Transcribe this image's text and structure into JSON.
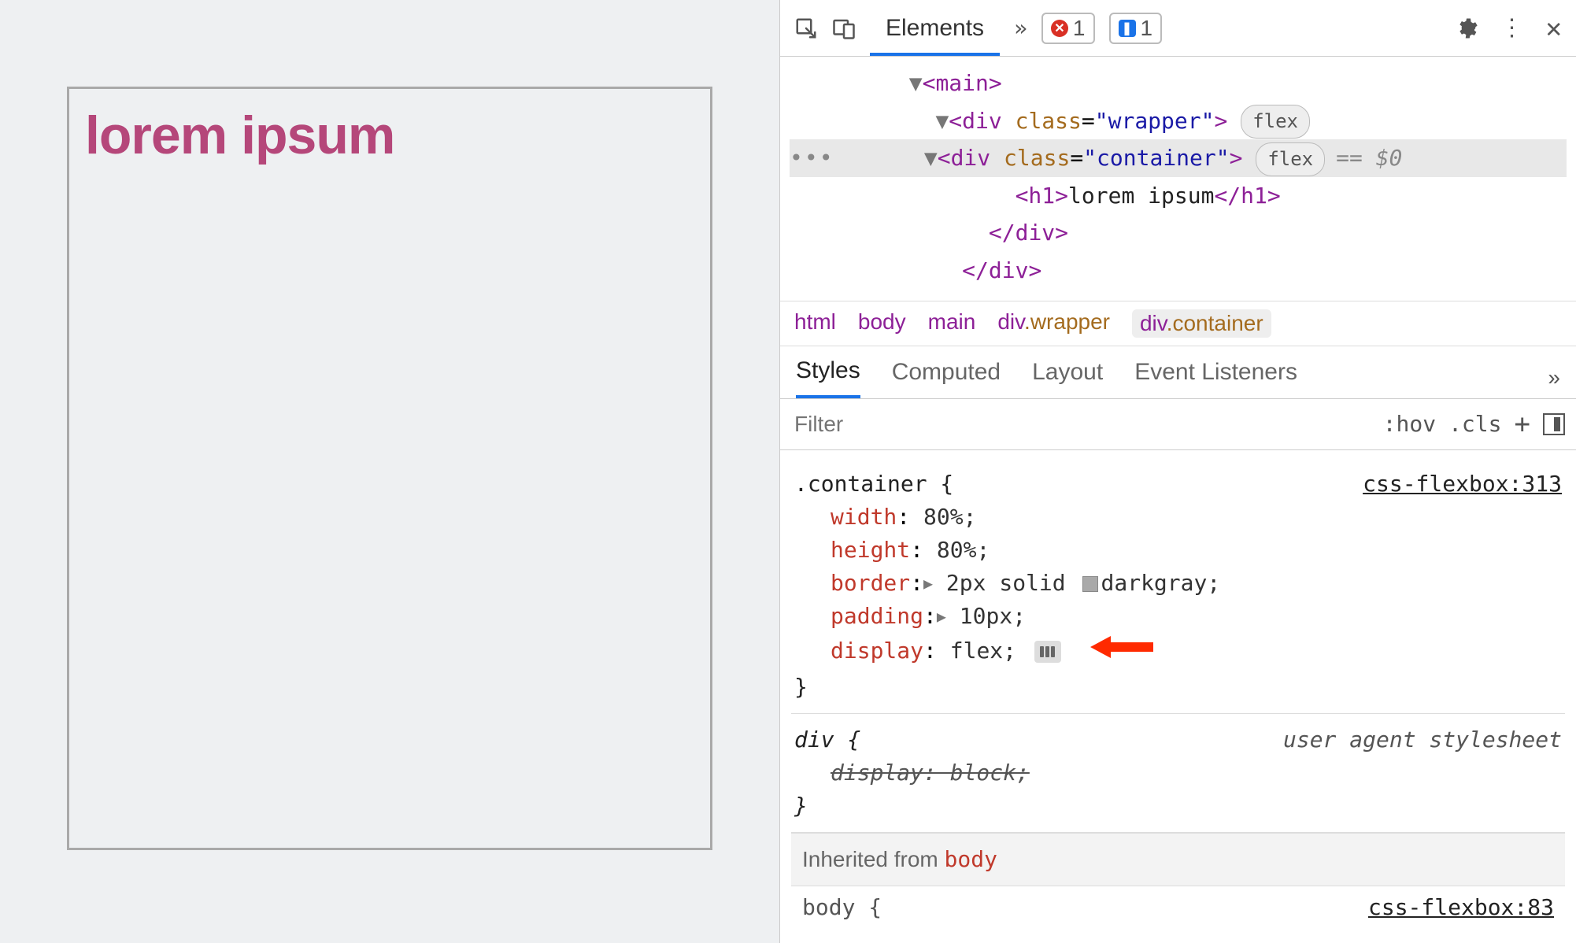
{
  "page": {
    "heading": "lorem ipsum"
  },
  "toolbar": {
    "tab": "Elements",
    "errors": "1",
    "issues": "1"
  },
  "dom": {
    "l1": {
      "tag": "main"
    },
    "l2": {
      "tag": "div",
      "attr": "class",
      "val": "wrapper",
      "badge": "flex"
    },
    "l3": {
      "tag": "div",
      "attr": "class",
      "val": "container",
      "badge": "flex",
      "eq0": "== $0"
    },
    "l4": {
      "open": "<h1>",
      "text": "lorem ipsum",
      "close": "</h1>"
    },
    "l5": {
      "close": "</div>"
    },
    "l6": {
      "close": "</div>"
    }
  },
  "crumbs": {
    "c1": "html",
    "c2": "body",
    "c3": "main",
    "c4": "div",
    "c4cls": ".wrapper",
    "c5": "div",
    "c5cls": ".container"
  },
  "subtabs": {
    "t1": "Styles",
    "t2": "Computed",
    "t3": "Layout",
    "t4": "Event Listeners"
  },
  "filter": {
    "placeholder": "Filter",
    "hov": ":hov",
    "cls": ".cls"
  },
  "rule1": {
    "selector": ".container {",
    "source": "css-flexbox:313",
    "p1": "width",
    "v1": "80%;",
    "p2": "height",
    "v2": "80%;",
    "p3": "border",
    "v3a": "2px solid",
    "v3b": "darkgray;",
    "p4": "padding",
    "v4": "10px;",
    "p5": "display",
    "v5": "flex;",
    "close": "}"
  },
  "rule2": {
    "selector": "div {",
    "source": "user agent stylesheet",
    "line": "display: block;",
    "close": "}"
  },
  "inherited": {
    "label": "Inherited from ",
    "el": "body"
  },
  "peek": {
    "sel": "body {",
    "src": "css-flexbox:83"
  }
}
